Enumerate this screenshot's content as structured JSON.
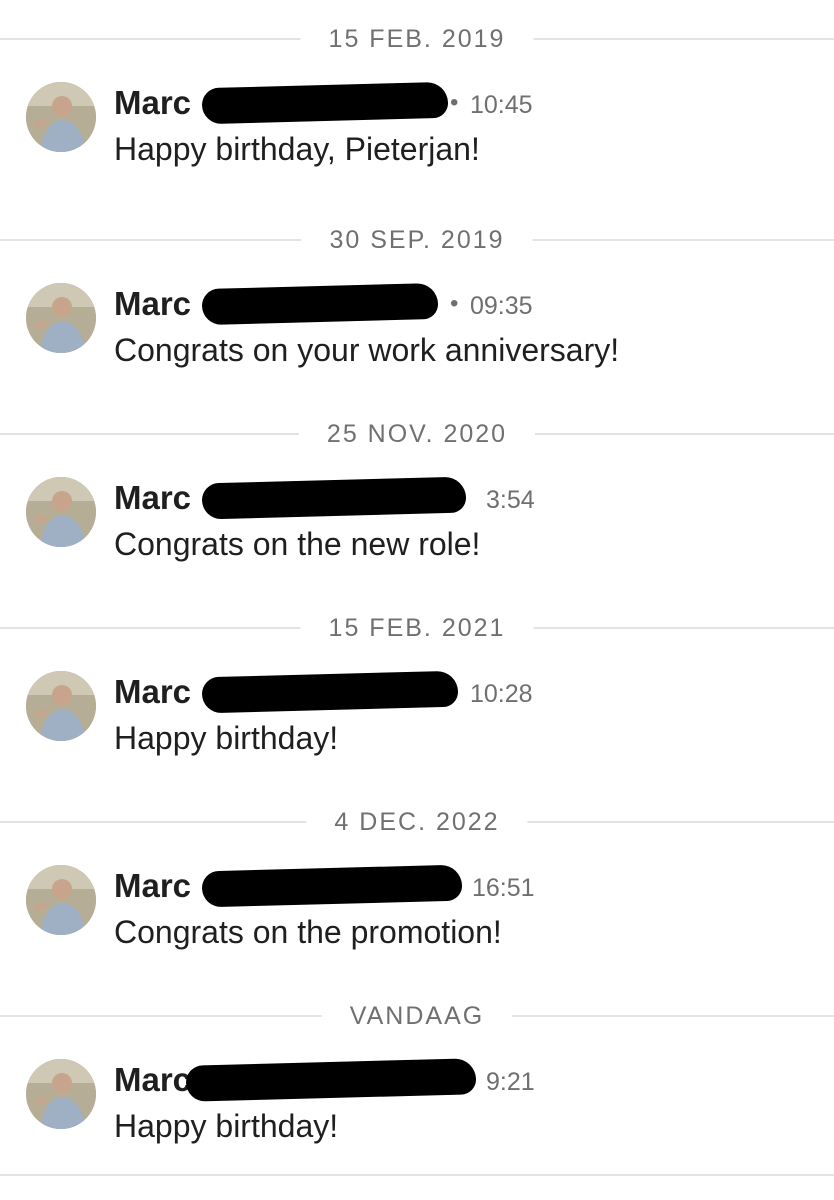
{
  "conversation": {
    "groups": [
      {
        "date": "15 FEB. 2019",
        "sender": "Marc",
        "time": "10:45",
        "show_dot": true,
        "message": "Happy birthday, Pieterjan!"
      },
      {
        "date": "30 SEP. 2019",
        "sender": "Marc",
        "time": "09:35",
        "show_dot": true,
        "message": "Congrats on your work anniversary!"
      },
      {
        "date": "25 NOV. 2020",
        "sender": "Marc",
        "time": "3:54",
        "show_dot": false,
        "message": "Congrats on the new role!"
      },
      {
        "date": "15 FEB. 2021",
        "sender": "Marc",
        "time": "10:28",
        "show_dot": false,
        "message": "Happy birthday!"
      },
      {
        "date": "4 DEC. 2022",
        "sender": "Marc",
        "time": "16:51",
        "show_dot": false,
        "message": "Congrats on the promotion!"
      },
      {
        "date": "VANDAAG",
        "sender": "Marc",
        "time": "9:21",
        "show_dot": false,
        "message": "Happy birthday!"
      }
    ]
  },
  "colors": {
    "text": "#1f1f1f",
    "meta": "#6f6f6f",
    "separator": "#e3e3e3",
    "redaction": "#000000"
  },
  "icons": {
    "avatar": "profile-photo",
    "dot": "bullet-dot"
  }
}
